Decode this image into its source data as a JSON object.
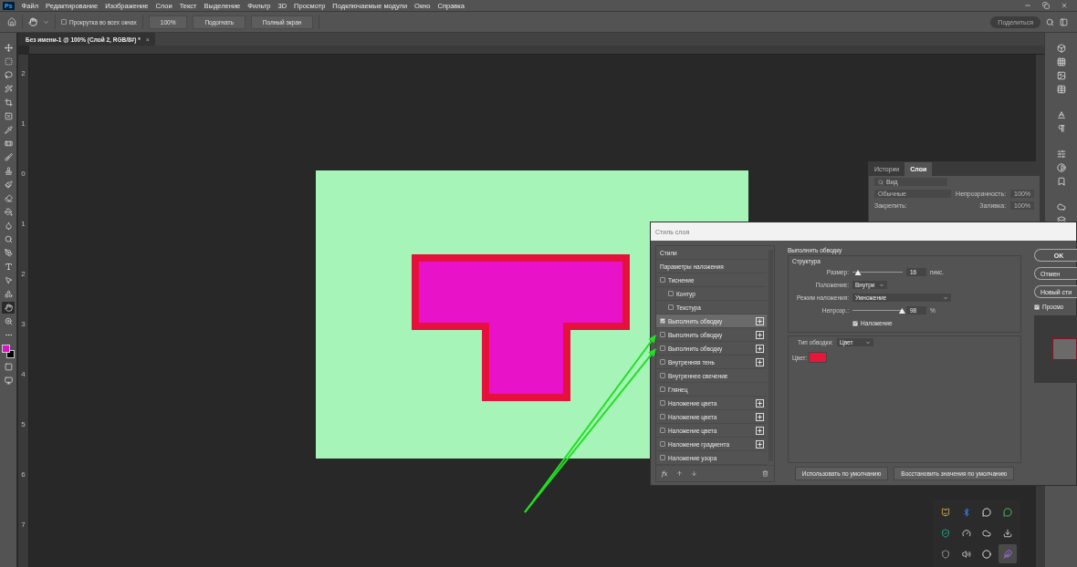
{
  "menu": {
    "logo": "Ps",
    "items": [
      "Файл",
      "Редактирование",
      "Изображение",
      "Слои",
      "Текст",
      "Выделение",
      "Фильтр",
      "3D",
      "Просмотр",
      "Подключаемые модули",
      "Окно",
      "Справка"
    ]
  },
  "options_bar": {
    "scroll_all": {
      "label": "Прокрутка во всех окнах",
      "checked": false
    },
    "buttons": [
      "100%",
      "Подогнать",
      "Полный экран"
    ],
    "share": "Поделиться"
  },
  "document_tab": {
    "title": "Без имени-1 @ 100% (Слой 2, RGB/8#) *",
    "close": "×"
  },
  "tools": [
    {
      "selected": false
    },
    {
      "selected": false
    },
    {
      "selected": false
    },
    {
      "selected": false
    },
    {
      "selected": false
    },
    {
      "selected": false
    },
    {
      "selected": false
    },
    {
      "selected": false
    },
    {
      "selected": false
    },
    {
      "selected": false
    },
    {
      "selected": false
    },
    {
      "selected": false
    },
    {
      "selected": false
    },
    {
      "selected": false
    },
    {
      "selected": false
    },
    {
      "selected": false
    },
    {
      "selected": false
    },
    {
      "selected": false
    },
    {
      "selected": false
    },
    {
      "selected": true
    },
    {
      "selected": false
    },
    {
      "selected": false
    }
  ],
  "swatches": [
    {
      "color": "#e010c8"
    },
    {
      "color": "#000000"
    }
  ],
  "ruler_labels": [
    "2",
    "1",
    "0",
    "1",
    "2",
    "3",
    "4",
    "5",
    "6",
    "7"
  ],
  "layers_panel": {
    "tabs": [
      {
        "label": "Истории",
        "selected": false
      },
      {
        "label": "Слои",
        "selected": true
      }
    ],
    "search_placeholder": "Вид",
    "blend_mode": "Обычные",
    "opacity_label": "Непрозрачность:",
    "opacity": "100%",
    "lock_label": "Закрепить:",
    "fill_label": "Заливка:",
    "fill": "100%"
  },
  "dialog": {
    "title": "Стиль слоя",
    "styles": [
      {
        "label": "Стили",
        "kind": "header",
        "selected": false
      },
      {
        "label": "Параметры наложения",
        "kind": "header",
        "selected": false
      },
      {
        "label": "Тиснение",
        "kind": "check",
        "checked": false,
        "addable": false,
        "selected": false,
        "children": [
          {
            "label": "Контур",
            "kind": "check",
            "checked": false,
            "addable": false,
            "selected": false
          },
          {
            "label": "Текстура",
            "kind": "check",
            "checked": false,
            "addable": false,
            "selected": false
          }
        ]
      },
      {
        "label": "Выполнить обводку",
        "kind": "check",
        "checked": true,
        "addable": true,
        "selected": true
      },
      {
        "label": "Выполнить обводку",
        "kind": "check",
        "checked": false,
        "addable": true,
        "selected": false
      },
      {
        "label": "Выполнить обводку",
        "kind": "check",
        "checked": false,
        "addable": true,
        "selected": false
      },
      {
        "label": "Внутренняя тень",
        "kind": "check",
        "checked": false,
        "addable": true,
        "selected": false
      },
      {
        "label": "Внутреннее свечение",
        "kind": "check",
        "checked": false,
        "addable": false,
        "selected": false
      },
      {
        "label": "Глянец",
        "kind": "check",
        "checked": false,
        "addable": false,
        "selected": false
      },
      {
        "label": "Наложение цвета",
        "kind": "check",
        "checked": false,
        "addable": true,
        "selected": false
      },
      {
        "label": "Наложение цвета",
        "kind": "check",
        "checked": false,
        "addable": true,
        "selected": false
      },
      {
        "label": "Наложение цвета",
        "kind": "check",
        "checked": false,
        "addable": true,
        "selected": false
      },
      {
        "label": "Наложение градиента",
        "kind": "check",
        "checked": false,
        "addable": true,
        "selected": false
      },
      {
        "label": "Наложение узора",
        "kind": "check",
        "checked": false,
        "addable": false,
        "selected": false
      }
    ],
    "fx_label": "fx",
    "section_title": "Выполнить обводку",
    "group_title": "Структура",
    "size": {
      "label": "Размер:",
      "level": 0.1,
      "value": "16",
      "unit": "пикс."
    },
    "position": {
      "label": "Положение:",
      "value": "Внутри"
    },
    "blend": {
      "label": "Режим наложения:",
      "value": "Умножение"
    },
    "opacity": {
      "label": "Непрозр.:",
      "level": 0.98,
      "value": "98",
      "unit": "%"
    },
    "overprint": {
      "label": "Наложение",
      "checked": true
    },
    "fill_type": {
      "label": "Тип обводки:",
      "value": "Цвет"
    },
    "color": {
      "label": "Цвет:",
      "color": "#e8173a"
    },
    "buttons": [
      "Использовать по умолчанию",
      "Восстановить значения по умолчанию"
    ],
    "side_buttons": [
      "OK",
      "Отмен",
      "Новый сти"
    ],
    "preview": {
      "label": "Просмо",
      "checked": true
    }
  },
  "tray_icons": [
    {
      "selected": false
    },
    {
      "selected": false
    },
    {
      "selected": false
    },
    {
      "selected": false
    },
    {
      "selected": false
    },
    {
      "selected": false
    },
    {
      "selected": false
    },
    {
      "selected": false
    },
    {
      "selected": false
    },
    {
      "selected": false
    },
    {
      "selected": false
    },
    {
      "selected": true
    }
  ]
}
